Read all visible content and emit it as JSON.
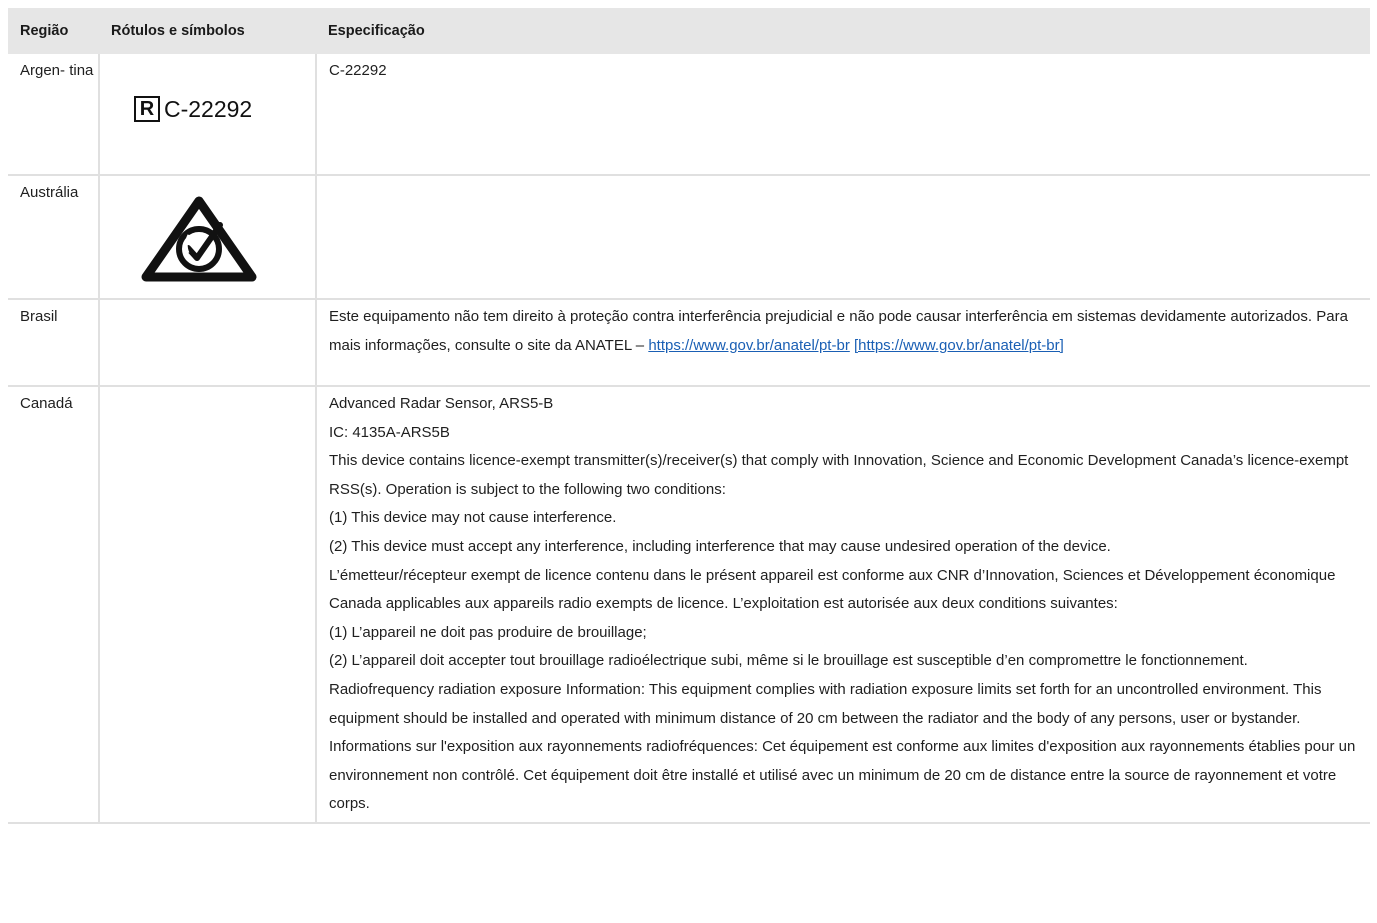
{
  "table": {
    "headers": {
      "region": "Região",
      "labels": "Rótulos e símbolos",
      "spec": "Especificação"
    },
    "rows": {
      "argentina": {
        "region": "Argen- tina",
        "symbol_code": "C-22292",
        "symbol_icon": "registered-r-box-icon",
        "spec": "C-22292"
      },
      "australia": {
        "region": "Austrália",
        "symbol_icon": "rcm-compliance-mark-icon"
      },
      "brasil": {
        "region": "Brasil",
        "spec_text": "Este equipamento não tem direito à proteção contra interferência prejudicial e não pode causar interferência em sistemas devidamente autorizados. Para mais informações, consulte o site da ANATEL – ",
        "spec_link": "https://www.gov.br/anatel/pt-br",
        "spec_link_bracket": "[https://www.gov.br/anatel/pt-br]"
      },
      "canada": {
        "region": "Canadá",
        "lines": [
          "Advanced Radar Sensor, ARS5-B",
          "IC: 4135A-ARS5B",
          "This device contains licence-exempt transmitter(s)/receiver(s) that comply with Innovation, Science and Economic Development Canada’s licence-exempt RSS(s). Operation is subject to the following two conditions:",
          "(1) This device may not cause interference.",
          "(2) This device must accept any interference, including interference that may cause undesired operation of the device.",
          "L’émetteur/récepteur exempt de licence contenu dans le présent appareil est conforme aux CNR d’Innovation, Sciences et Développement économique Canada applicables aux appareils radio exempts de licence. L’exploitation est autorisée aux deux conditions suivantes:",
          "(1) L’appareil ne doit pas produire de brouillage;",
          "(2) L’appareil doit accepter tout brouillage radioélectrique subi, même si le brouillage est susceptible d’en compromettre le fonctionnement.",
          "Radiofrequency radiation exposure Information: This equipment complies with radiation exposure limits set forth for an uncontrolled environment. This equipment should be installed and operated with minimum distance of 20 cm between the radiator and the body of any persons, user or bystander.",
          "Informations sur l'exposition aux rayonnements radiofréquences: Cet équipement est conforme aux limites d'exposition aux rayonnements établies pour un environnement non contrôlé. Cet équipement doit être installé et utilisé avec un minimum de 20 cm de distance entre la source de rayonnement et votre corps."
        ]
      }
    }
  },
  "colors": {
    "header_bg": "#e6e6e6",
    "border": "#e0e0e0",
    "link": "#1a5fb4",
    "text": "#1f1f1f"
  }
}
